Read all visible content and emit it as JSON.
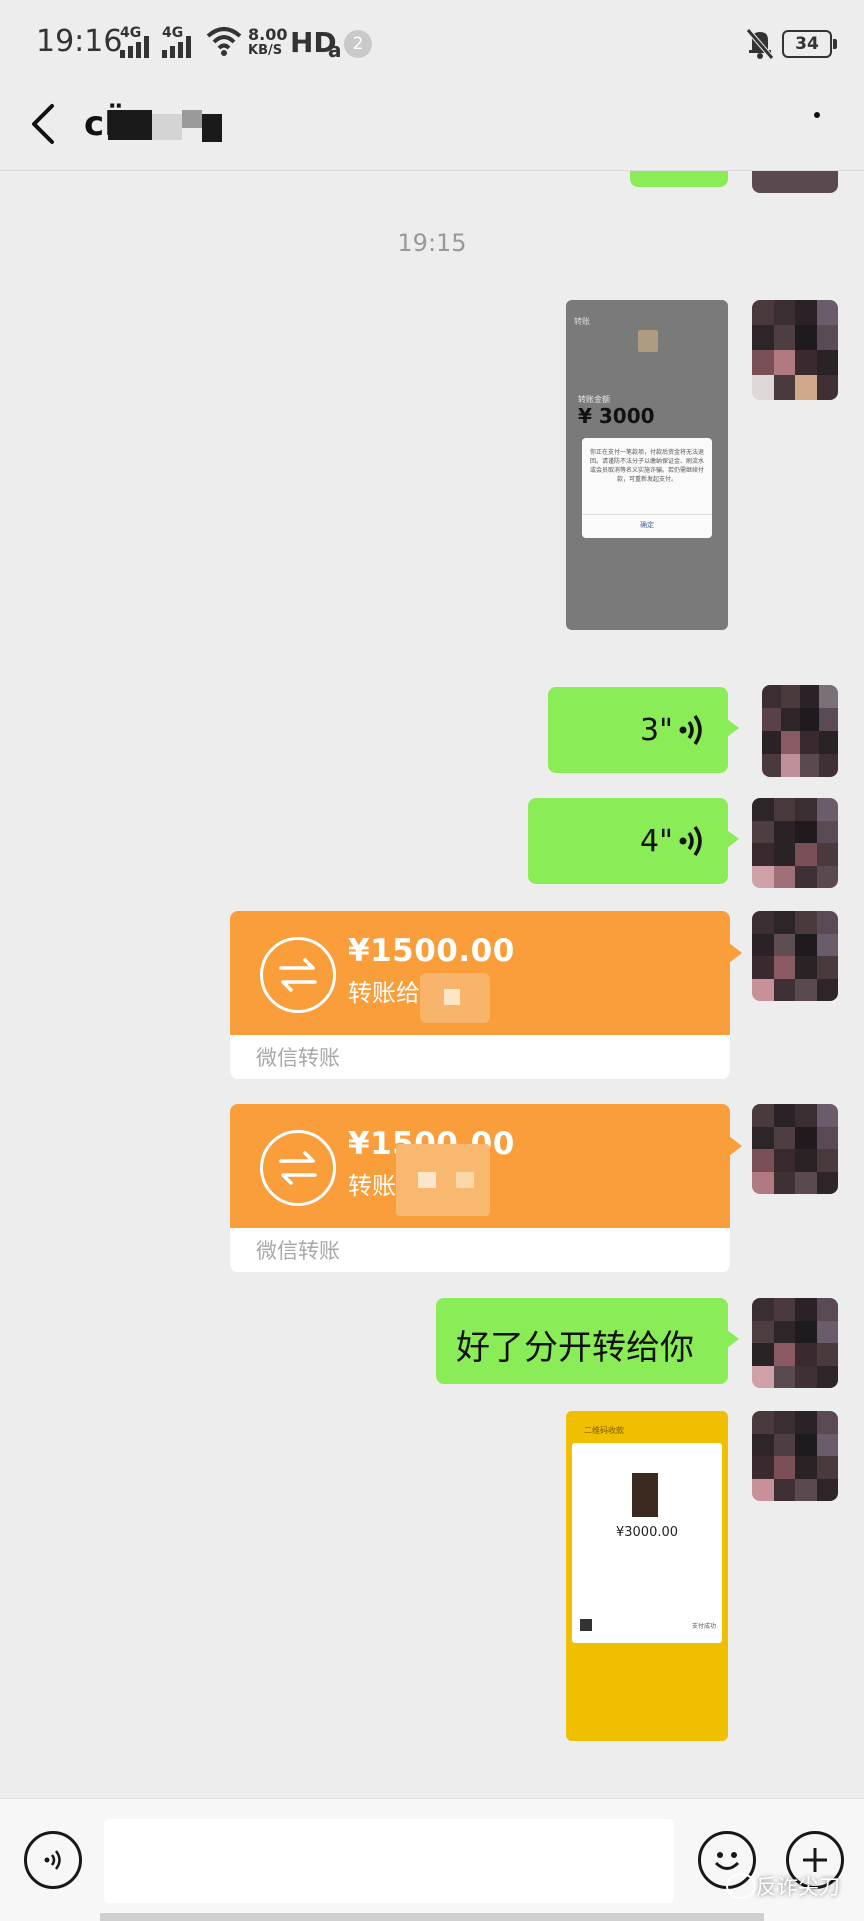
{
  "status_bar": {
    "time": "19:16",
    "network_1": "4G",
    "network_2": "4G",
    "speed_value": "8.00",
    "speed_unit": "KB/S",
    "hd_label": "HD",
    "hd_sub": "a",
    "notification_count": "2",
    "battery": "34"
  },
  "nav": {
    "contact_name_visible": "сЁ"
  },
  "chat": {
    "time_separator": "19:15",
    "screenshot_1": {
      "label_title": "转账",
      "label_amount_title": "转账金额",
      "amount": "3000",
      "dialog_text": "你正在支付一笔款项，付款后资金将无法退回。请谨防不法分子以缴纳保证金、刷流水或会员取消等名义实施诈骗。若仍需继续付款，可重新发起支付。",
      "dialog_button": "确定"
    },
    "voice_1": "3\"",
    "voice_2": "4\"",
    "transfer_1": {
      "amount": "¥1500.00",
      "note": "转账给",
      "footer": "微信转账"
    },
    "transfer_2": {
      "amount": "¥1500.00",
      "note": "转账",
      "footer": "微信转账"
    },
    "text_message": "好了分开转给你",
    "screenshot_2": {
      "header": "二维码收款",
      "amount": "¥3000.00",
      "footer_right": "支付成功"
    }
  },
  "input_bar": {
    "placeholder": ""
  },
  "watermark": "反诈尖刀",
  "colors": {
    "bubble_green": "#8aec56",
    "transfer_orange": "#fa9d3b",
    "background": "#ededed"
  }
}
